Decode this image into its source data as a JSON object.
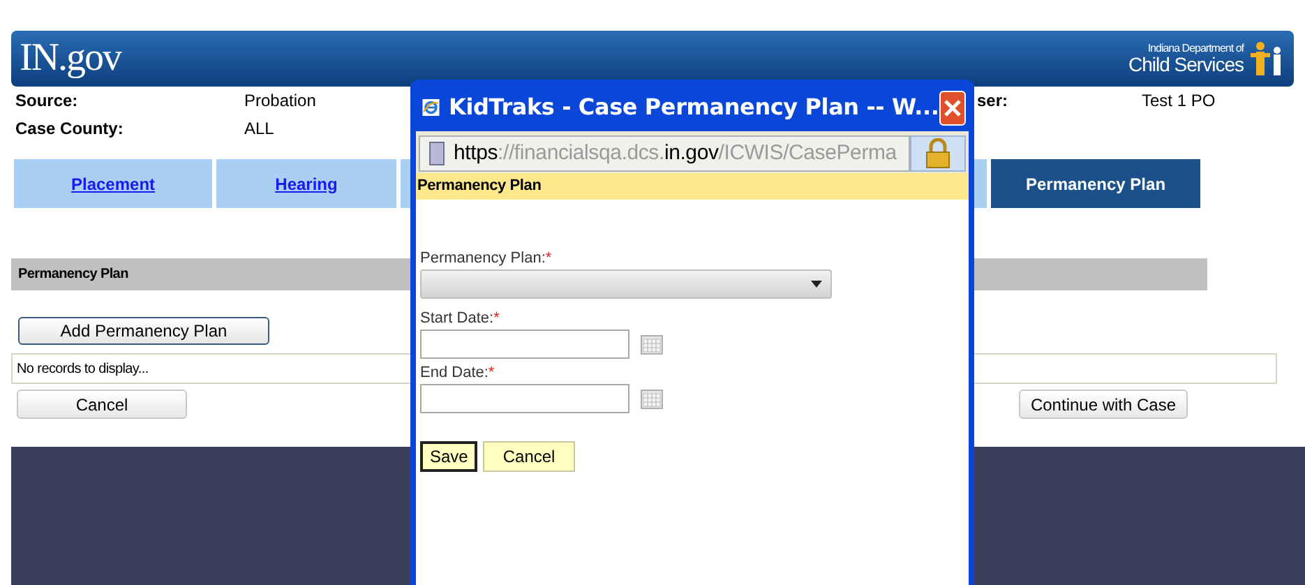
{
  "header": {
    "logo": "IN.gov",
    "agency_line1": "Indiana Department of",
    "agency_line2": "Child Services"
  },
  "info": [
    {
      "label": "Source:",
      "value": "Probation"
    },
    {
      "label": "Case County:",
      "value": "ALL"
    }
  ],
  "user": {
    "label": "ser:",
    "value": "Test 1 PO"
  },
  "tabs": [
    {
      "label": "Placement",
      "selected": false
    },
    {
      "label": "Hearing",
      "selected": false
    },
    {
      "label": "Permanency Plan",
      "selected": true
    }
  ],
  "section": {
    "title": "Permanency Plan",
    "add_button": "Add Permanency Plan",
    "empty_message": "No records to display...",
    "buttons": [
      "Cancel",
      "Continue with Case"
    ]
  },
  "dialog": {
    "title": "KidTraks - Case Permanency Plan -- W...",
    "url": [
      {
        "text": "https",
        "emphasis": true
      },
      {
        "text": "://financialsqa.dcs.",
        "emphasis": false
      },
      {
        "text": "in.gov",
        "emphasis": true
      },
      {
        "text": "/ICWIS/CasePerma",
        "emphasis": false
      }
    ],
    "band": "Permanency Plan",
    "fields": [
      {
        "kind": "select",
        "label": "Permanency Plan:",
        "required_mark": "*"
      },
      {
        "kind": "date",
        "label": "Start Date:",
        "required_mark": "*"
      },
      {
        "kind": "date",
        "label": "End Date:",
        "required_mark": "*"
      }
    ],
    "buttons": [
      {
        "label": "Save",
        "focused": true
      },
      {
        "label": "Cancel",
        "focused": false
      }
    ]
  }
}
